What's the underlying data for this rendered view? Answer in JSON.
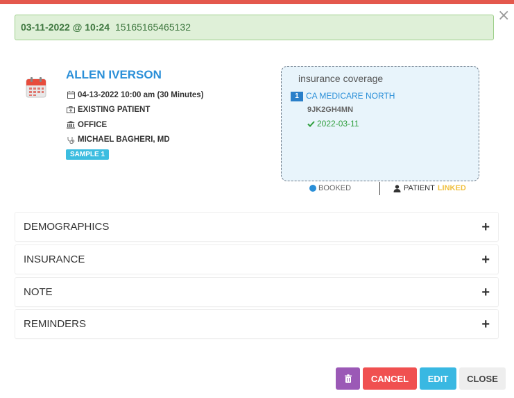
{
  "alert": {
    "datetime": "03-11-2022 @ 10:24",
    "code": "15165165465132"
  },
  "dialog": {
    "close_glyph": "×"
  },
  "appointment": {
    "patient_name": "ALLEN IVERSON",
    "when": "04-13-2022 10:00 am (30 Minutes)",
    "visit_type": "EXISTING PATIENT",
    "location": "OFFICE",
    "provider": "MICHAEL BAGHERI, MD",
    "tag": "SAMPLE 1"
  },
  "insurance_panel": {
    "title": "insurance coverage",
    "entries": [
      {
        "rank": "1",
        "plan": "CA MEDICARE NORTH",
        "member_id": "9JK2GH4MN",
        "verified_date": "2022-03-11"
      }
    ]
  },
  "status": {
    "booking": "BOOKED",
    "patient_label": "PATIENT",
    "patient_state": "LINKED"
  },
  "sections": [
    {
      "label": "DEMOGRAPHICS",
      "toggle": "+"
    },
    {
      "label": "INSURANCE",
      "toggle": "+"
    },
    {
      "label": "NOTE",
      "toggle": "+"
    },
    {
      "label": "REMINDERS",
      "toggle": "+"
    }
  ],
  "buttons": {
    "cancel": "CANCEL",
    "edit": "EDIT",
    "close": "CLOSE"
  },
  "icons": {
    "calendar": "calendar-icon",
    "trash": "trash-icon"
  },
  "colors": {
    "accent": "#2a8fd8",
    "danger": "#f05050",
    "info": "#39b8e2",
    "purple": "#9b59b6",
    "success": "#2e9e3c",
    "warning": "#f0c040",
    "top_stripe": "#e4584d"
  }
}
